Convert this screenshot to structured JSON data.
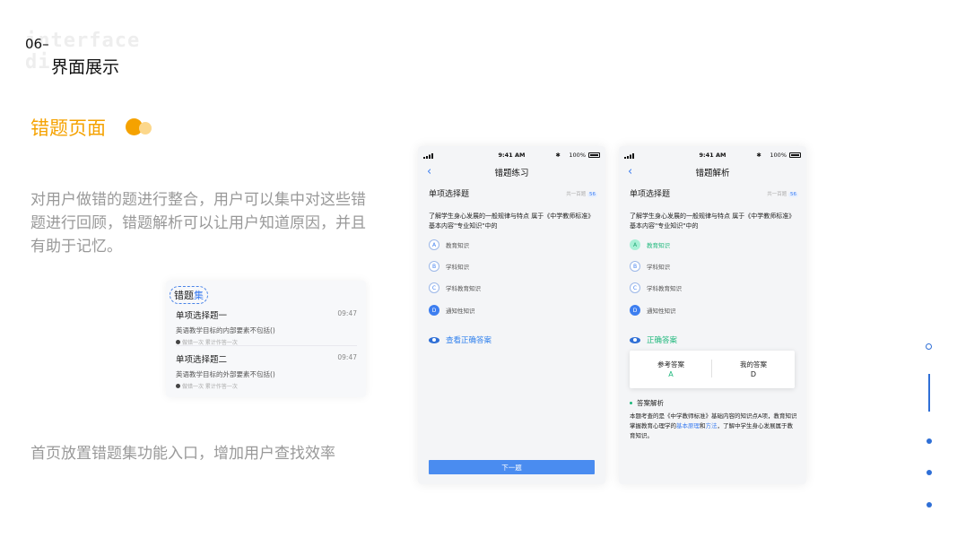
{
  "header": {
    "ghost_line1": "interface",
    "ghost_line2": "di",
    "section_number": "06–",
    "section_title": "界面展示"
  },
  "page": {
    "heading": "错题页面",
    "description": "对用户做错的题进行整合，用户可以集中对这些错题进行回顾，错题解析可以让用户知道原因，并且有助于记忆。",
    "description2": "首页放置错题集功能入口，增加用户查找效率"
  },
  "card": {
    "title_prefix": "错题",
    "title_highlight": "集",
    "items": [
      {
        "title": "单项选择题一",
        "time": "09:47",
        "text": "英语教学目标的内部要素不包括()",
        "meta": "做错一次 累计作答一次"
      },
      {
        "title": "单项选择题二",
        "time": "09:47",
        "text": "英语教学目标的外部要素不包括()",
        "meta": "做错一次 累计作答一次"
      }
    ]
  },
  "phone1": {
    "status_time": "9:41 AM",
    "battery": "100%",
    "back": "‹",
    "title": "错题练习",
    "section": "单项选择题",
    "counter_prefix": "共一百题",
    "counter_num": "56",
    "question": "了解学生身心发展的一般规律与特点 属于《中学教师标准》基本内容\"专业知识\"中的",
    "options": [
      {
        "letter": "A",
        "label": "教育知识"
      },
      {
        "letter": "B",
        "label": "学科知识"
      },
      {
        "letter": "C",
        "label": "学科教育知识"
      },
      {
        "letter": "D",
        "label": "通知性知识"
      }
    ],
    "answer_link": "查看正确答案",
    "next_button": "下一题"
  },
  "phone2": {
    "status_time": "9:41 AM",
    "battery": "100%",
    "back": "‹",
    "title": "错题解析",
    "section": "单项选择题",
    "counter_prefix": "共一百题",
    "counter_num": "56",
    "question": "了解学生身心发展的一般规律与特点 属于《中学教师标准》基本内容\"专业知识\"中的",
    "options": [
      {
        "letter": "A",
        "label": "教育知识"
      },
      {
        "letter": "B",
        "label": "学科知识"
      },
      {
        "letter": "C",
        "label": "学科教育知识"
      },
      {
        "letter": "D",
        "label": "通知性知识"
      }
    ],
    "correct_label": "正确答案",
    "reference_answer_label": "参考答案",
    "reference_answer_value": "A",
    "my_answer_label": "我的答案",
    "my_answer_value": "D",
    "analysis_title": "答案解析",
    "analysis_part1": "本题考查的是《中学教师标准》基础内容的知识点A项，教育知识掌握教育心理学的",
    "analysis_link1": "基本原理",
    "analysis_part2": "和",
    "analysis_link2": "方法",
    "analysis_part3": "，了解中学生身心发展属于教育知识。"
  },
  "colors": {
    "accent_orange": "#f5a200",
    "accent_blue": "#3d7ef0",
    "correct_green": "#1fb87c",
    "muted_text": "#999999"
  }
}
